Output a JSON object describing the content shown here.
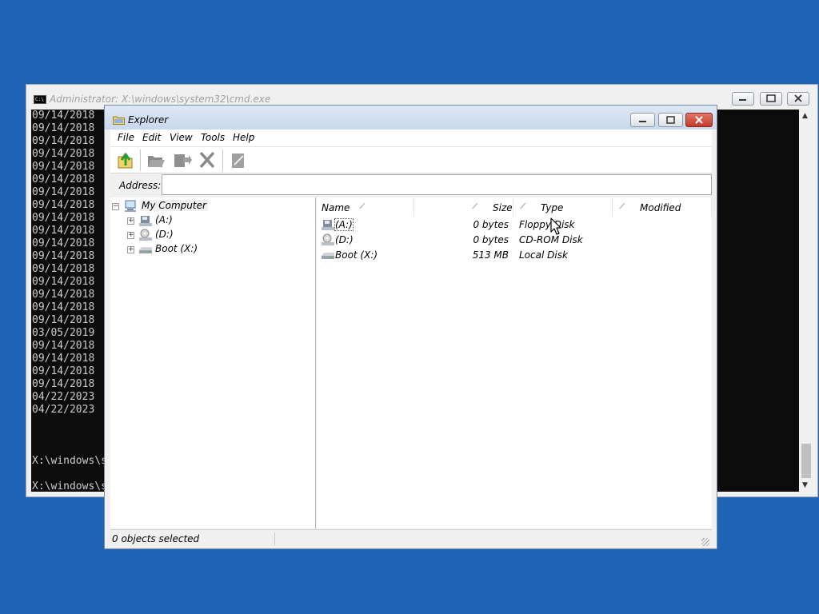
{
  "cmd_window": {
    "title": "Administrator: X:\\windows\\system32\\cmd.exe",
    "lines": [
      "09/14/2018",
      "09/14/2018",
      "09/14/2018",
      "09/14/2018",
      "09/14/2018",
      "09/14/2018",
      "09/14/2018",
      "09/14/2018",
      "09/14/2018",
      "09/14/2018",
      "09/14/2018",
      "09/14/2018",
      "09/14/2018",
      "09/14/2018",
      "09/14/2018",
      "09/14/2018",
      "09/14/2018",
      "03/05/2019",
      "09/14/2018",
      "09/14/2018",
      "09/14/2018",
      "09/14/2018",
      "04/22/2023",
      "04/22/2023",
      "",
      "",
      "",
      "X:\\windows\\s",
      "",
      "X:\\windows\\s"
    ]
  },
  "explorer": {
    "title": "Explorer",
    "menu": [
      "File",
      "Edit",
      "View",
      "Tools",
      "Help"
    ],
    "toolbar": [
      {
        "name": "up-folder-button",
        "icon": "up-folder-icon"
      },
      {
        "name": "open-button",
        "icon": "open-folder-icon"
      },
      {
        "name": "move-button",
        "icon": "move-icon"
      },
      {
        "name": "delete-button",
        "icon": "delete-x-icon"
      },
      {
        "name": "properties-button",
        "icon": "properties-icon"
      }
    ],
    "address": {
      "label": "Address:",
      "value": ""
    },
    "tree": {
      "root": "My Computer",
      "children": [
        "(A:)",
        "(D:)",
        "Boot (X:)"
      ]
    },
    "columns": {
      "name": "Name",
      "size": "Size",
      "type": "Type",
      "modified": "Modified"
    },
    "rows": [
      {
        "name": "(A:)",
        "size": "0 bytes",
        "type": "Floppy Disk",
        "icon": "floppy-drive-icon"
      },
      {
        "name": "(D:)",
        "size": "0 bytes",
        "type": "CD-ROM Disk",
        "icon": "cdrom-drive-icon"
      },
      {
        "name": "Boot (X:)",
        "size": "513 MB",
        "type": "Local Disk",
        "icon": "local-disk-icon"
      }
    ],
    "status": "0 objects selected"
  },
  "colors": {
    "desktop": "#1f64b4",
    "console_bg": "#0c0c0c",
    "console_text": "#cccccc",
    "close_button": "#c94535"
  }
}
